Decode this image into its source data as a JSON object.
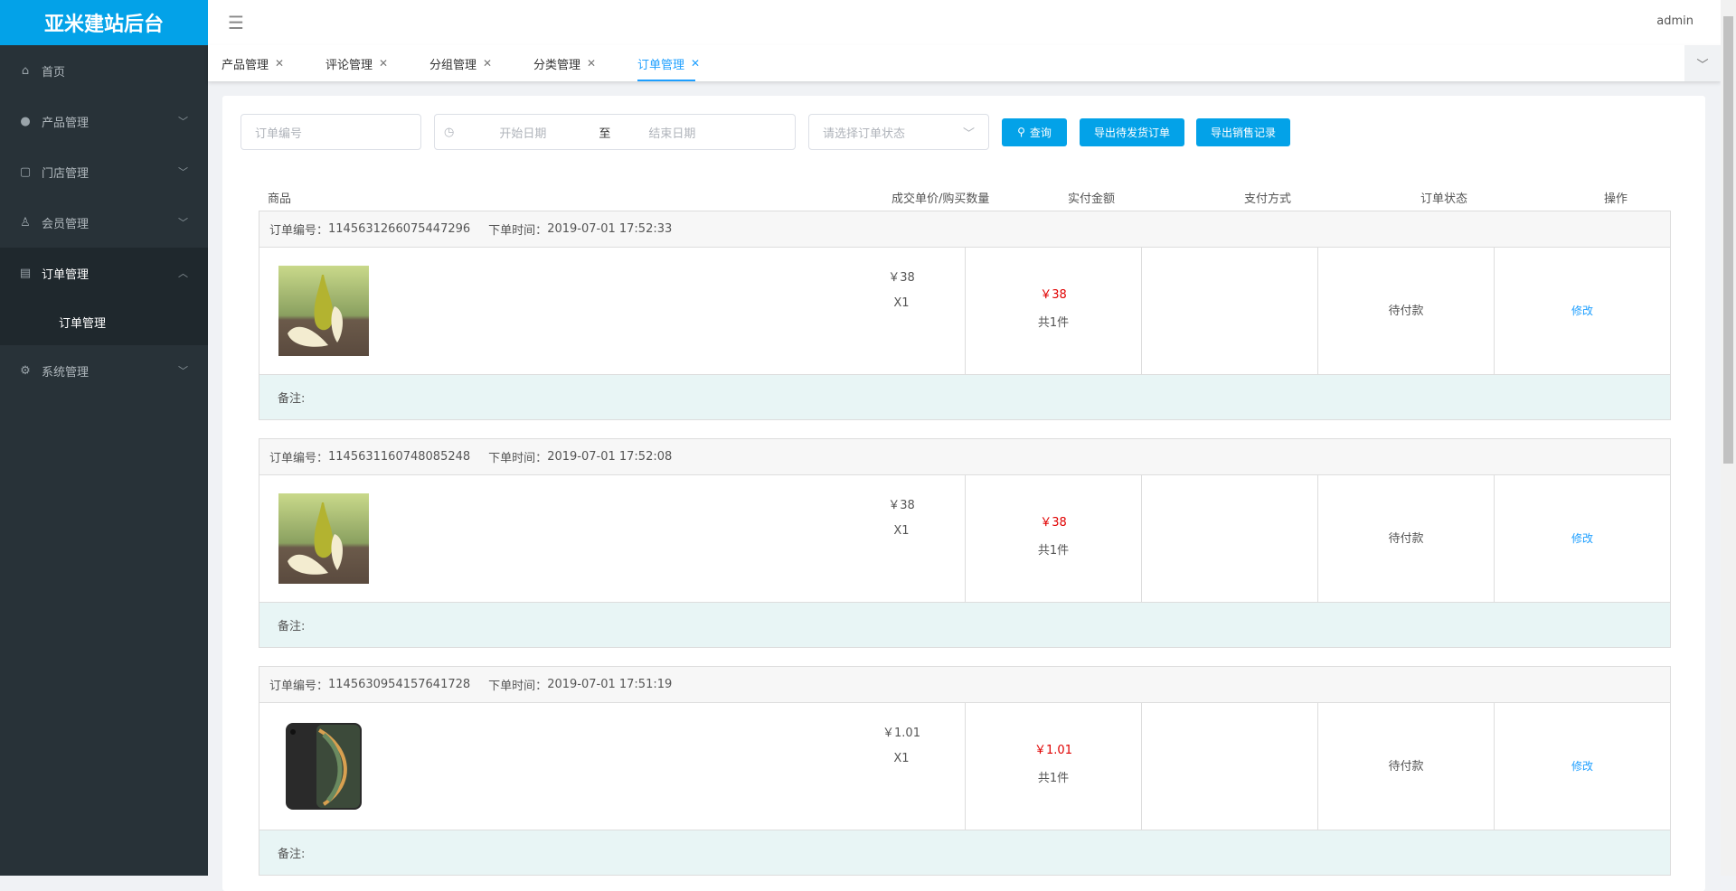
{
  "app": {
    "title": "亚米建站后台",
    "user": "admin"
  },
  "sidebar": {
    "items": [
      {
        "label": "首页",
        "icon": "home-icon"
      },
      {
        "label": "产品管理",
        "icon": "user-icon"
      },
      {
        "label": "门店管理",
        "icon": "store-icon"
      },
      {
        "label": "会员管理",
        "icon": "member-icon"
      },
      {
        "label": "订单管理",
        "icon": "document-icon",
        "open": true,
        "children": [
          {
            "label": "订单管理"
          }
        ]
      },
      {
        "label": "系统管理",
        "icon": "gear-icon"
      }
    ]
  },
  "tabs": [
    {
      "label": "产品管理"
    },
    {
      "label": "评论管理"
    },
    {
      "label": "分组管理"
    },
    {
      "label": "分类管理"
    },
    {
      "label": "订单管理",
      "active": true
    }
  ],
  "filters": {
    "order_no_placeholder": "订单编号",
    "start_placeholder": "开始日期",
    "range_sep": "至",
    "end_placeholder": "结束日期",
    "status_placeholder": "请选择订单状态",
    "query": "查询",
    "export_pending": "导出待发货订单",
    "export_sales": "导出销售记录"
  },
  "table": {
    "headers": [
      "商品",
      "成交单价/购买数量",
      "实付金额",
      "支付方式",
      "订单状态",
      "操作"
    ],
    "order_no_label": "订单编号：",
    "time_label": "下单时间：",
    "remark_label": "备注:",
    "edit": "修改"
  },
  "orders": [
    {
      "order_no": "1145631266075447296",
      "time": "2019-07-01 17:52:33",
      "unit_price": "￥38",
      "qty": "X1",
      "paid": "￥38",
      "count": "共1件",
      "payment": "",
      "status": "待付款",
      "image": "pear"
    },
    {
      "order_no": "1145631160748085248",
      "time": "2019-07-01 17:52:08",
      "unit_price": "￥38",
      "qty": "X1",
      "paid": "￥38",
      "count": "共1件",
      "payment": "",
      "status": "待付款",
      "image": "pear"
    },
    {
      "order_no": "1145630954157641728",
      "time": "2019-07-01 17:51:19",
      "unit_price": "￥1.01",
      "qty": "X1",
      "paid": "￥1.01",
      "count": "共1件",
      "payment": "",
      "status": "待付款",
      "image": "phone"
    }
  ],
  "colors": {
    "brand": "#03a2e8",
    "sidebar": "#283238",
    "price": "#e00000",
    "link": "#1e9fff"
  }
}
